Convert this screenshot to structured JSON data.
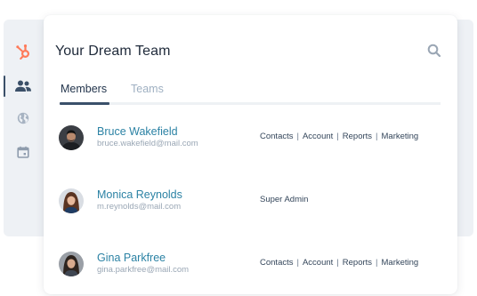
{
  "header": {
    "title": "Your Dream Team"
  },
  "tabs": [
    {
      "label": "Members",
      "active": true
    },
    {
      "label": "Teams",
      "active": false
    }
  ],
  "sidebar": {
    "items": [
      {
        "icon": "hubspot-logo-icon",
        "active": false
      },
      {
        "icon": "people-icon",
        "active": true
      },
      {
        "icon": "globe-icon",
        "active": false
      },
      {
        "icon": "calendar-icon",
        "active": false
      }
    ]
  },
  "members": [
    {
      "name": "Bruce Wakefield",
      "email": "bruce.wakefield@mail.com",
      "permissions": [
        "Contacts",
        "Account",
        "Reports",
        "Marketing"
      ]
    },
    {
      "name": "Monica Reynolds",
      "email": "m.reynolds@mail.com",
      "permissions": [
        "Super Admin"
      ]
    },
    {
      "name": "Gina Parkfree",
      "email": "gina.parkfree@mail.com",
      "permissions": [
        "Contacts",
        "Account",
        "Reports",
        "Marketing"
      ]
    }
  ],
  "colors": {
    "accent": "#2b82a4",
    "brand": "#ff7a59",
    "nav_active": "#3a4f68"
  }
}
